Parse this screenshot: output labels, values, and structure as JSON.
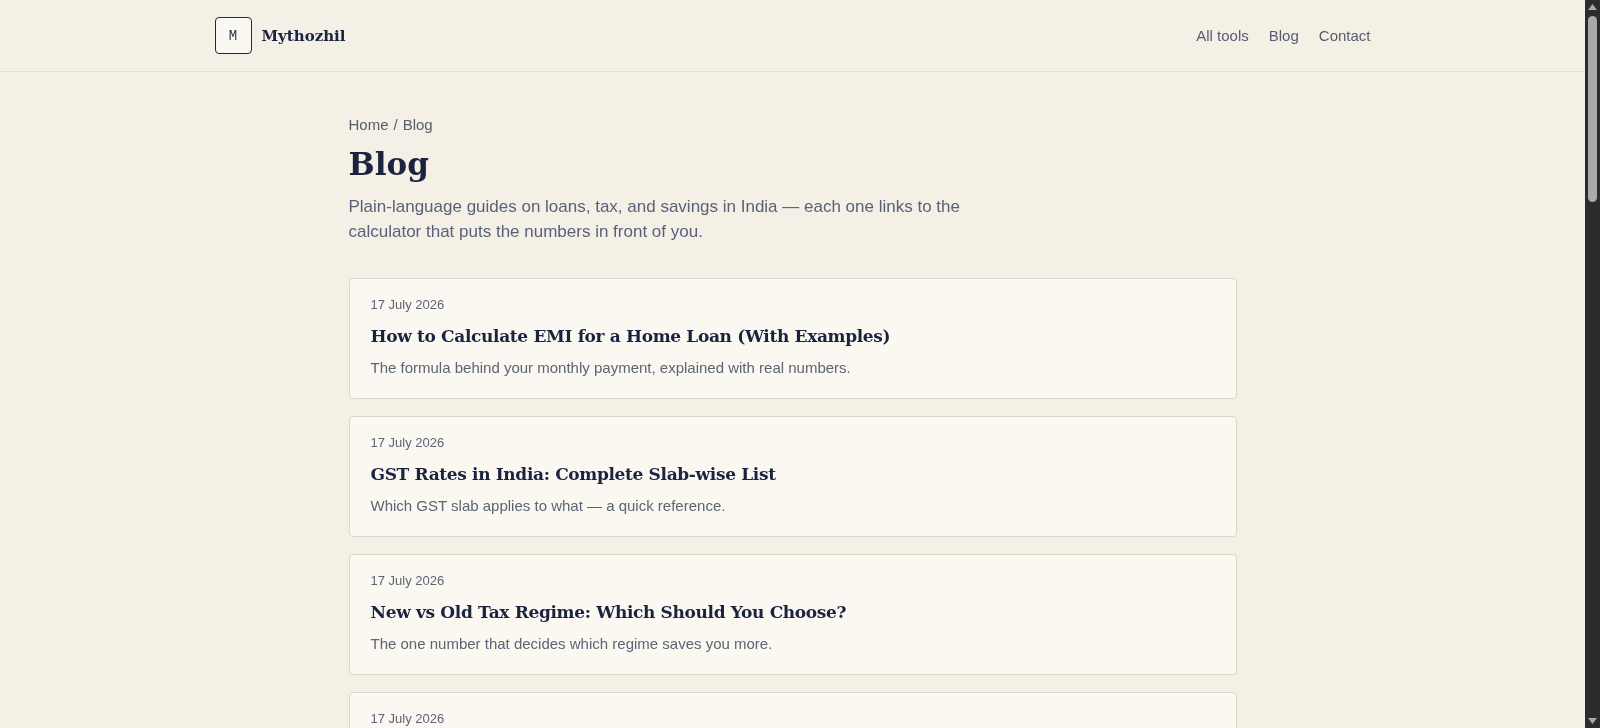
{
  "header": {
    "logo": {
      "mark": "M",
      "name": "Mythozhil"
    },
    "nav": [
      {
        "label": "All tools"
      },
      {
        "label": "Blog"
      },
      {
        "label": "Contact"
      }
    ]
  },
  "breadcrumb": {
    "links": [
      {
        "label": "Home"
      }
    ],
    "separator": "/",
    "current": "Blog"
  },
  "page": {
    "title": "Blog",
    "description": "Plain-language guides on loans, tax, and savings in India — each one links to the calculator that puts the numbers in front of you."
  },
  "posts": [
    {
      "date": "17 July 2026",
      "title": "How to Calculate EMI for a Home Loan (With Examples)",
      "excerpt": "The formula behind your monthly payment, explained with real numbers."
    },
    {
      "date": "17 July 2026",
      "title": "GST Rates in India: Complete Slab-wise List",
      "excerpt": "Which GST slab applies to what — a quick reference."
    },
    {
      "date": "17 July 2026",
      "title": "New vs Old Tax Regime: Which Should You Choose?",
      "excerpt": "The one number that decides which regime saves you more."
    },
    {
      "date": "17 July 2026"
    }
  ]
}
